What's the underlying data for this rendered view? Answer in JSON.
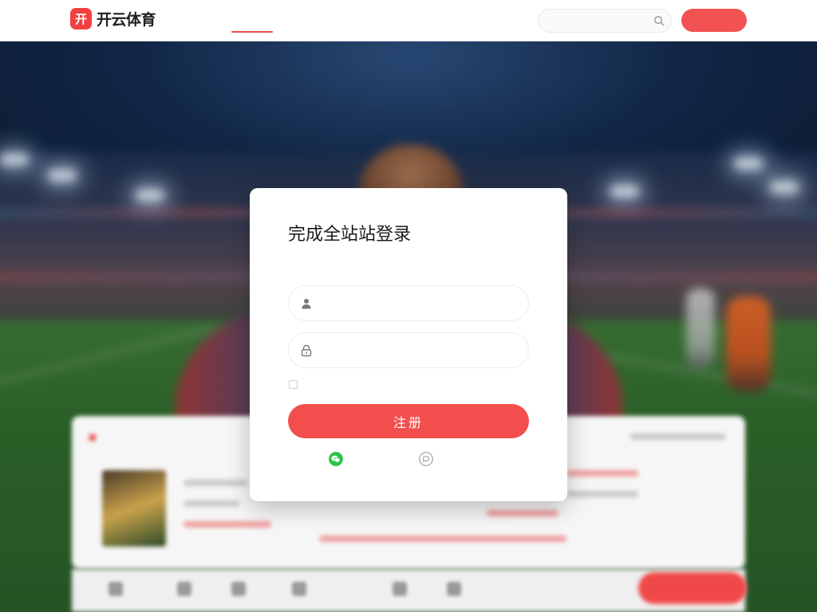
{
  "header": {
    "logo_mark": "开",
    "logo_text": "开云体育",
    "nav": [
      {
        "label": "",
        "active": true
      },
      {
        "label": "",
        "active": false
      },
      {
        "label": "",
        "active": false
      }
    ],
    "search": {
      "placeholder": ""
    },
    "cta_label": ""
  },
  "modal": {
    "title": "完成全站站登录",
    "subtitle": "",
    "username_placeholder": "",
    "password_placeholder": "",
    "remember_label": "",
    "forgot_label": "",
    "submit_label": "注册",
    "alt_wechat_label": "",
    "alt_third_label": ""
  },
  "background": {
    "card_title": "",
    "divider_text": ""
  },
  "colors": {
    "accent": "#f24e4e",
    "link": "#2f7fd8",
    "remember": "#ef8a3c",
    "wechat": "#2dc24a"
  }
}
